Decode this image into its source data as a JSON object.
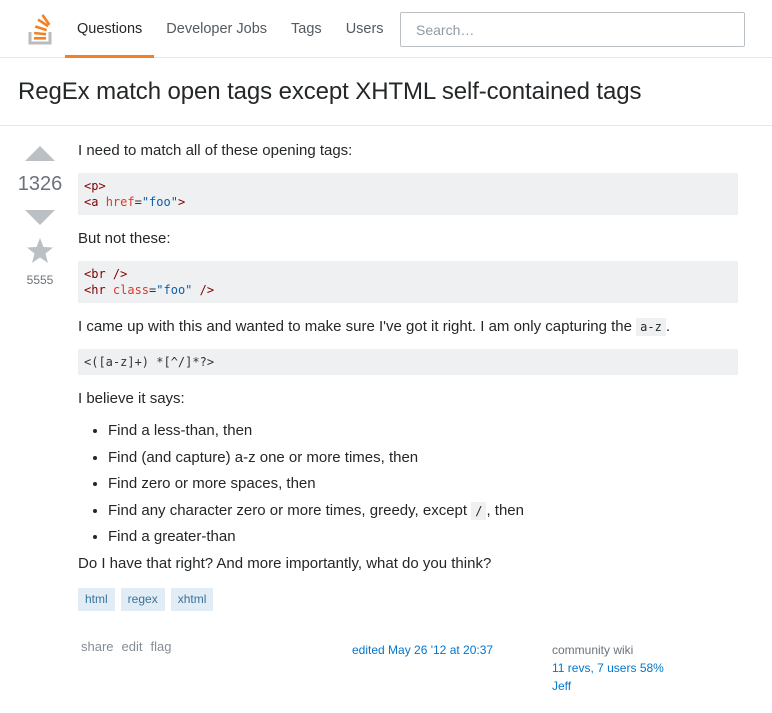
{
  "nav": {
    "items": [
      "Questions",
      "Developer Jobs",
      "Tags",
      "Users"
    ],
    "active": "Questions",
    "search_placeholder": "Search…"
  },
  "colors": {
    "accent": "#f48024",
    "link": "#0077cc",
    "tag_bg": "#e1ecf4",
    "tag_text": "#39739d"
  },
  "question": {
    "title": "RegEx match open tags except XHTML self-contained tags",
    "votes": "1326",
    "favorites": "5555",
    "intro": "I need to match all of these opening tags:",
    "code1": {
      "line1_tag": "<p>",
      "line2_open": "<a ",
      "line2_attr": "href",
      "line2_eq": "=",
      "line2_val": "\"foo\"",
      "line2_close": ">"
    },
    "but_not": "But not these:",
    "code2": {
      "line1_tag": "<br />",
      "line2_open": "<hr ",
      "line2_attr": "class",
      "line2_eq": "=",
      "line2_val": "\"foo\"",
      "line2_close": " />"
    },
    "came_up": "I came up with this and wanted to make sure I've got it right. I am only capturing the",
    "came_up_code": "a-z",
    "came_up_end": ".",
    "regex": "<([a-z]+) *[^/]*?>",
    "believe": "I believe it says:",
    "list": [
      "Find a less-than, then",
      "Find (and capture) a-z one or more times, then",
      "Find zero or more spaces, then",
      "Find any character zero or more times, greedy, except",
      "Find a greater-than"
    ],
    "list_item4_code": "/",
    "list_item4_end": ", then",
    "closing": "Do I have that right? And more importantly, what do you think?",
    "tags": [
      "html",
      "regex",
      "xhtml"
    ],
    "menu": [
      "share",
      "edit",
      "flag"
    ],
    "edited": "edited May 26 '12 at 20:37",
    "owner": {
      "cw": "community wiki",
      "revs": "11 revs, 7 users 58%",
      "user": "Jeff"
    }
  },
  "icons": {
    "logo": "stackoverflow-logo-icon",
    "vote_up": "triangle-up-icon",
    "vote_down": "triangle-down-icon",
    "favorite": "star-icon"
  }
}
